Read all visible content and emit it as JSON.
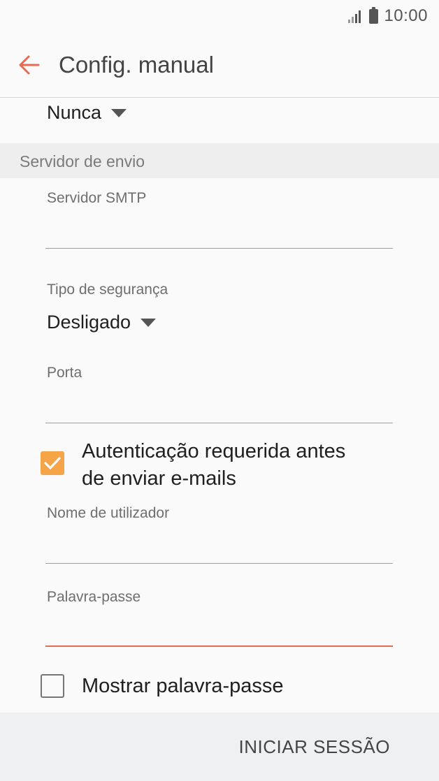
{
  "status_bar": {
    "time": "10:00",
    "icons": [
      "signal-icon",
      "battery-icon"
    ]
  },
  "app_bar": {
    "title": "Config. manual",
    "back_icon": "arrow-left-icon"
  },
  "incoming": {
    "dropdown_value": "Nunca"
  },
  "outgoing_section": {
    "header": "Servidor de envio",
    "smtp_server": {
      "label": "Servidor SMTP",
      "value": ""
    },
    "security_type": {
      "label": "Tipo de segurança",
      "value": "Desligado"
    },
    "port": {
      "label": "Porta",
      "value": ""
    },
    "auth_required": {
      "label_line1": "Autenticação requerida antes",
      "label_line2": "de enviar e-mails",
      "checked": true
    },
    "username": {
      "label": "Nome de utilizador",
      "value": ""
    },
    "password": {
      "label": "Palavra-passe",
      "value": ""
    },
    "show_password": {
      "label": "Mostrar palavra-passe",
      "checked": false
    }
  },
  "bottom_bar": {
    "sign_in_label": "INICIAR SESSÃO"
  },
  "colors": {
    "accent": "#e56c52",
    "checkbox_checked": "#f5a447",
    "background": "#fafafa"
  }
}
